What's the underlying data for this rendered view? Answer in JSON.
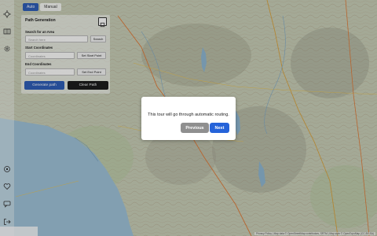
{
  "mode_tabs": {
    "auto_label": "Auto",
    "manual_label": "Manual"
  },
  "panel": {
    "title": "Path Generation",
    "search_label": "Search for an Area",
    "search_placeholder": "Search here",
    "search_button": "Search",
    "start_label": "Start Coordinates",
    "start_placeholder": "Coordinates",
    "start_button": "Set Start Point",
    "end_label": "End Coordinates",
    "end_placeholder": "Coordinates",
    "end_button": "Set End Point",
    "generate_button": "Generate path",
    "clear_button": "Clear Path"
  },
  "tour": {
    "message": "This tour will go through automatic routing.",
    "previous_label": "Previous",
    "next_label": "Next"
  },
  "attribution": "Privacy Policy | Map data © OpenStreetMap contributors, SRTM | Map style © OpenTopoMap (CC-BY-SA)",
  "colors": {
    "accent": "#2f5fb8",
    "next": "#2563d9",
    "dark": "#1d1d1d",
    "previous": "#8f8f8f",
    "sea": "#9fc3d8"
  },
  "icons": [
    "crosshair-icon",
    "layers-icon",
    "settings-icon",
    "target-icon",
    "heart-icon",
    "chat-icon",
    "logout-icon",
    "layers-toggle-icon"
  ]
}
